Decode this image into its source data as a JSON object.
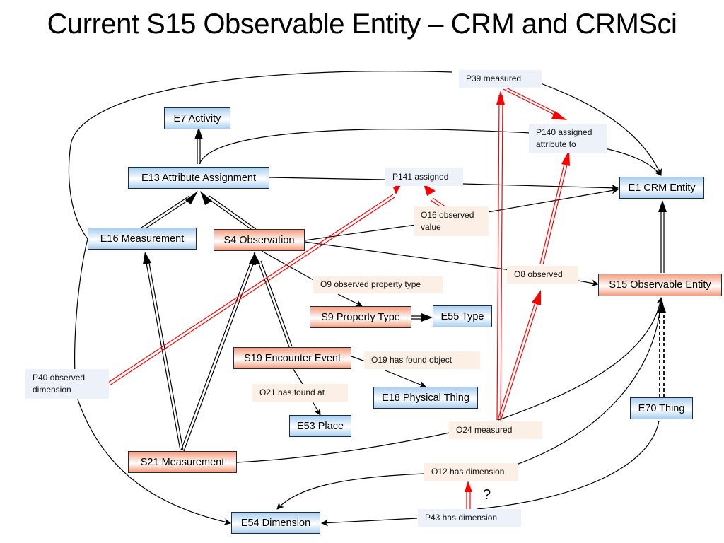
{
  "title": "Current S15 Observable Entity – CRM and CRMSci",
  "nodes": {
    "e7": "E7 Activity",
    "e13": "E13 Attribute Assignment",
    "e16": "E16 Measurement",
    "s4": "S4 Observation",
    "e1": "E1 CRM Entity",
    "s15": "S15 Observable Entity",
    "s9": "S9 Property Type",
    "e55": "E55 Type",
    "s19": "S19 Encounter Event",
    "e18": "E18 Physical Thing",
    "e53": "E53 Place",
    "e70": "E70 Thing",
    "s21": "S21 Measurement",
    "e54": "E54 Dimension"
  },
  "properties": {
    "p39": "P39 measured",
    "p140_l1": "P140 assigned",
    "p140_l2": "attribute to",
    "p141": "P141 assigned",
    "o16_l1": "O16 observed",
    "o16_l2": "value",
    "o8": "O8 observed",
    "o9": "O9 observed property type",
    "o19": "O19 has found object",
    "p40_l1": "P40 observed",
    "p40_l2": "dimension",
    "o21": "O21 has found at",
    "o24": "O24 measured",
    "o12": "O12 has dimension",
    "p43": "P43 has dimension"
  },
  "annotation": "?",
  "legend_colors": {
    "crm_class": "#a9cff0",
    "crmsci_class": "#f39d7c",
    "crm_property_label": "#edf2fa",
    "crmsci_property_label": "#fcefe6",
    "subproperty_link": "#ff0000"
  }
}
